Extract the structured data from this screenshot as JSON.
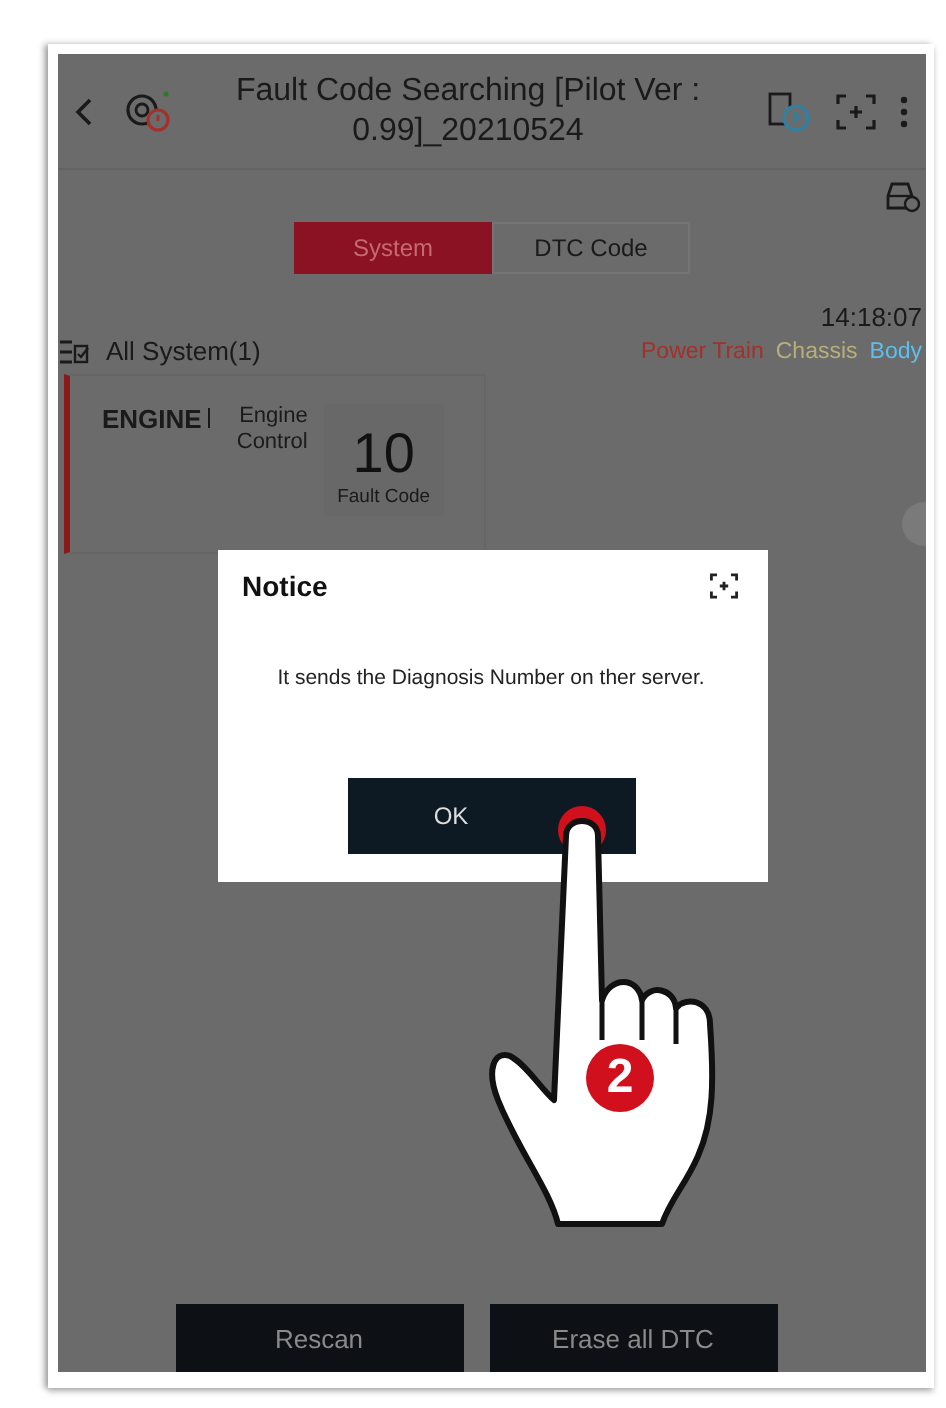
{
  "header": {
    "title": "Fault Code Searching [Pilot Ver : 0.99]_20210524"
  },
  "tabs": [
    {
      "label": "System",
      "selected": true
    },
    {
      "label": "DTC Code",
      "selected": false
    }
  ],
  "time": "14:18:07",
  "system_list": {
    "title": "All System(1)"
  },
  "legend": [
    {
      "label": "Power Train",
      "color": "#a3302a"
    },
    {
      "label": "Chassis",
      "color": "#b8ae7a"
    },
    {
      "label": "Body",
      "color": "#5cc0ee"
    }
  ],
  "systems": [
    {
      "name": "ENGINE",
      "description": "Engine Control",
      "fault_count": "10",
      "count_label": "Fault Code"
    }
  ],
  "dialog": {
    "title": "Notice",
    "message": "It sends the Diagnosis Number on ther server.",
    "button": "OK"
  },
  "tap_hint": {
    "step": "2"
  },
  "buttons": [
    "Rescan",
    "Erase all DTC"
  ]
}
